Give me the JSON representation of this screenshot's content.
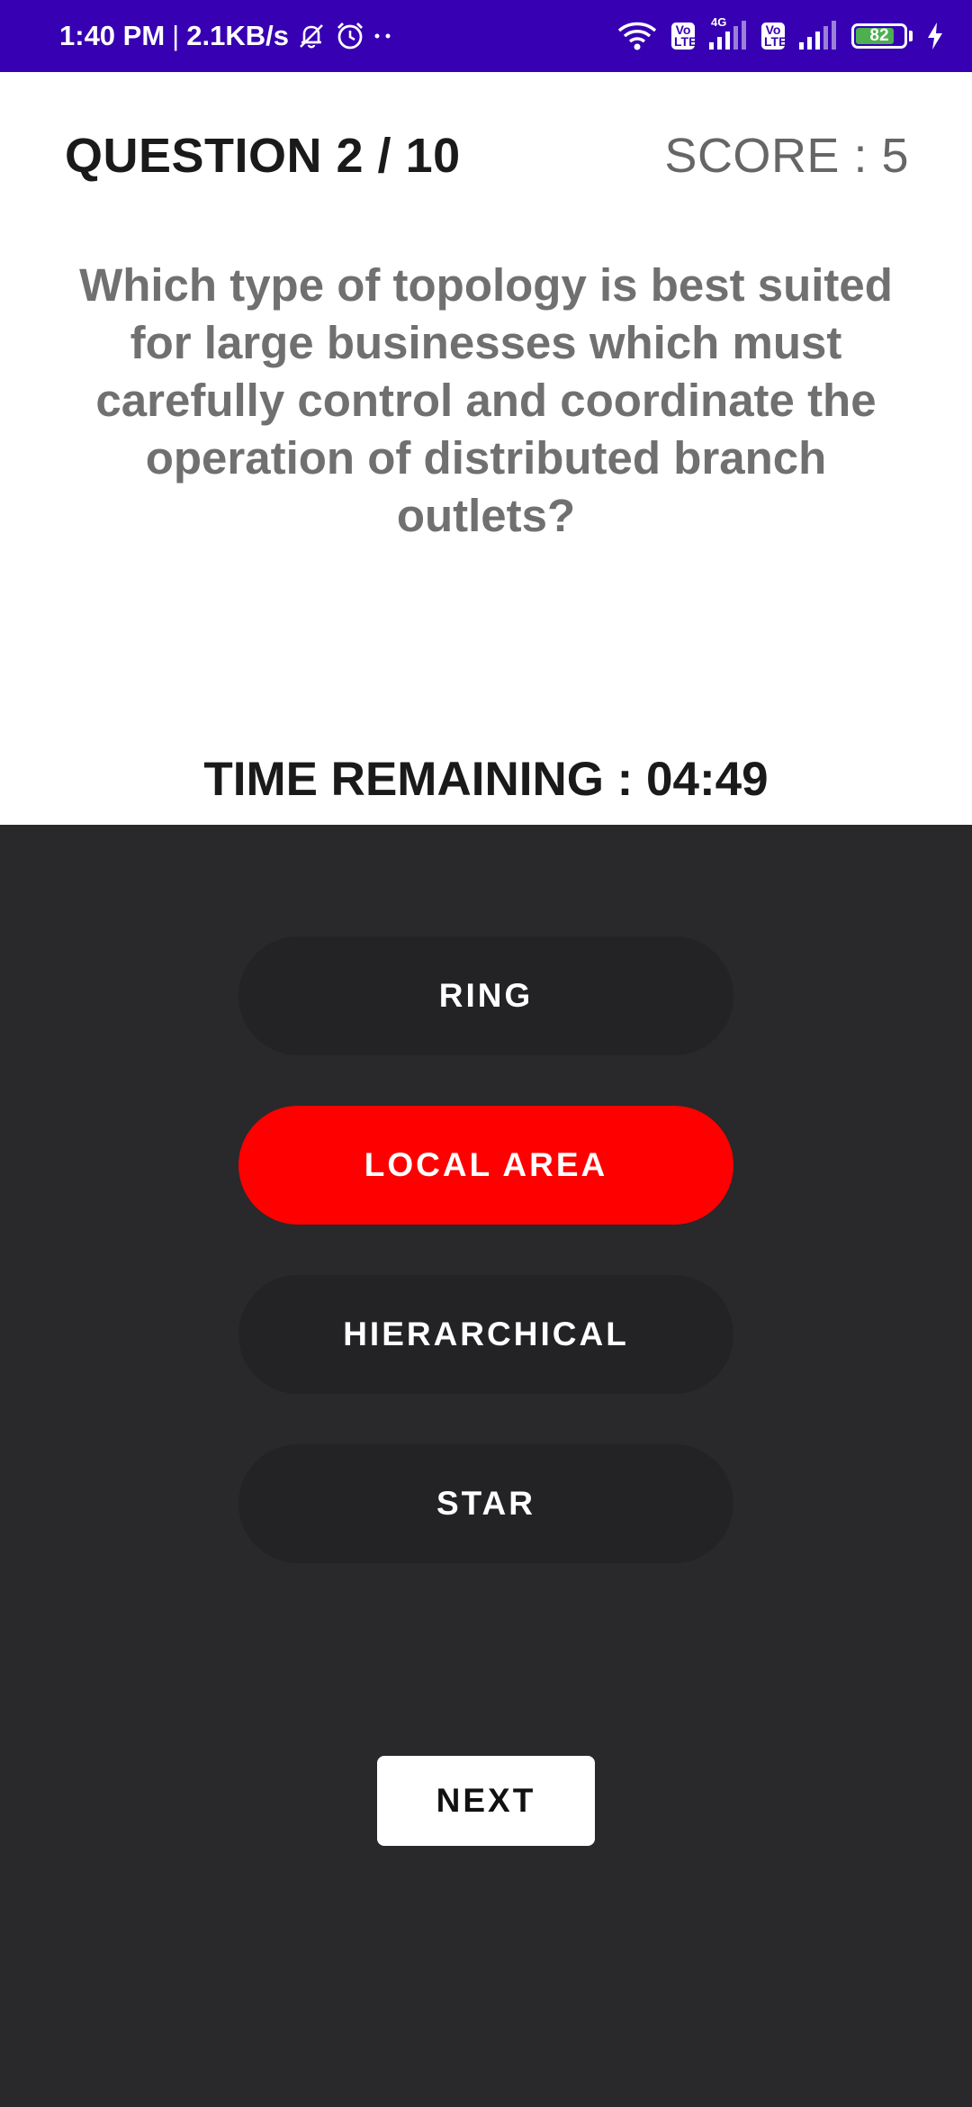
{
  "status_bar": {
    "time": "1:40 PM",
    "separator": "|",
    "network_speed": "2.1KB/s",
    "icons": [
      "mute-icon",
      "alarm-icon",
      "more-dots-icon",
      "wifi-icon",
      "volte-icon",
      "signal-icon",
      "signal-icon",
      "battery-icon",
      "charging-icon"
    ],
    "volte_label_1": "Vo",
    "volte_label_2": "LTE",
    "network_type": "4G",
    "battery_level": "82",
    "battery_fraction": 0.82,
    "background_color": "#3700b3",
    "battery_color": "#4caf50"
  },
  "quiz": {
    "question_counter": "QUESTION 2 / 10",
    "score": "SCORE : 5",
    "question": "Which type of topology is best suited for large businesses which must carefully control and coordinate the operation of distributed branch outlets?",
    "time_remaining": "TIME REMAINING : 04:49"
  },
  "answers": [
    {
      "label": "RING",
      "selected": false
    },
    {
      "label": "LOCAL AREA",
      "selected": true
    },
    {
      "label": "HIERARCHICAL",
      "selected": false
    },
    {
      "label": "STAR",
      "selected": false
    }
  ],
  "next_label": "NEXT",
  "colors": {
    "panel_background": "#29282b",
    "answer_background": "#232225",
    "selected_answer": "#ff0000",
    "question_text": "#707070"
  }
}
